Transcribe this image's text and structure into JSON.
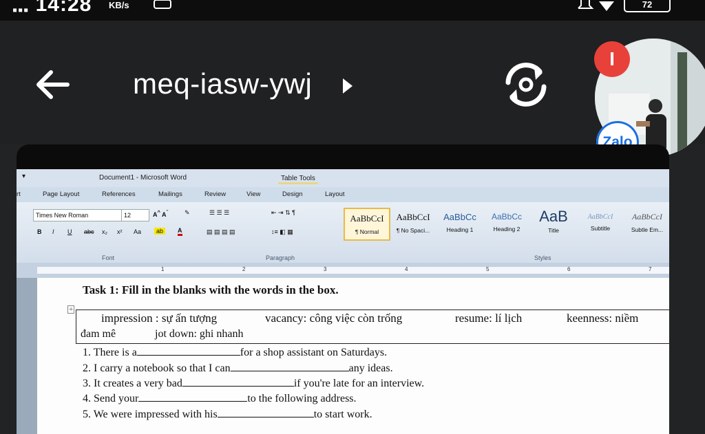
{
  "status": {
    "time": "14:28",
    "speed": "KB/s",
    "battery": "72"
  },
  "header": {
    "title": "meq-iasw-ywj",
    "avatar_badge": "I",
    "zalo_label": "Zalo"
  },
  "word": {
    "window_title": "Document1 - Microsoft Word",
    "context_tab": "Table Tools",
    "tabs": [
      "rt",
      "Page Layout",
      "References",
      "Mailings",
      "Review",
      "View",
      "Design",
      "Layout"
    ],
    "font_name": "Times New Roman",
    "font_size": "12",
    "groups": {
      "font": "Font",
      "paragraph": "Paragraph",
      "styles": "Styles"
    },
    "styles": [
      {
        "sample": "AaBbCcI",
        "label": "¶ Normal",
        "color": "#1b1b1b"
      },
      {
        "sample": "AaBbCcI",
        "label": "¶ No Spaci...",
        "color": "#1b1b1b"
      },
      {
        "sample": "AaBbCc",
        "label": "Heading 1",
        "color": "#2a5a9a"
      },
      {
        "sample": "AaBbCc",
        "label": "Heading 2",
        "color": "#3d6fb0"
      },
      {
        "sample": "AaB",
        "label": "Title",
        "color": "#1f3d66"
      },
      {
        "sample": "AaBbCcI",
        "label": "Subtitle",
        "color": "#7a96bc"
      },
      {
        "sample": "AaBbCcI",
        "label": "Subtle Em...",
        "color": "#555"
      }
    ],
    "ruler_marks": [
      "1",
      "2",
      "3",
      "4",
      "5",
      "6",
      "7"
    ]
  },
  "document": {
    "task": "Task 1: Fill in the blanks with the words in the box.",
    "box_line1": [
      "impression : sự ấn tượng",
      "vacancy: công việc còn trống",
      "resume: lí lịch",
      "keenness: niềm"
    ],
    "box_line2": [
      "đam mê",
      "jot down: ghi nhanh"
    ],
    "questions": [
      {
        "pre": "1. There is a",
        "post": "for a shop assistant on Saturdays."
      },
      {
        "pre": "2. I carry a notebook so that I can",
        "post": "any ideas."
      },
      {
        "pre": "3. It creates a very bad",
        "post": "if you're late for an interview."
      },
      {
        "pre": "4. Send your",
        "post": "to the following address."
      },
      {
        "pre": "5. We were impressed with his",
        "post": "to start work."
      }
    ]
  }
}
